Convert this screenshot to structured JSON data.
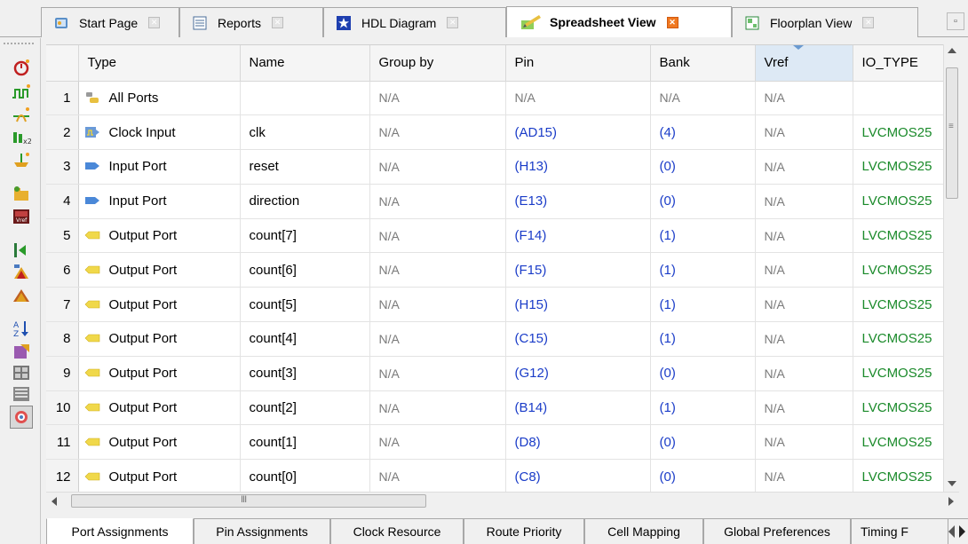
{
  "tabs": [
    {
      "label": "Start Page",
      "icon": "start-page-icon",
      "active": false
    },
    {
      "label": "Reports",
      "icon": "reports-icon",
      "active": false
    },
    {
      "label": "HDL Diagram",
      "icon": "hdl-diagram-icon",
      "active": false
    },
    {
      "label": "Spreadsheet View",
      "icon": "spreadsheet-icon",
      "active": true
    },
    {
      "label": "Floorplan View",
      "icon": "floorplan-icon",
      "active": false
    }
  ],
  "grid": {
    "columns": [
      "Type",
      "Name",
      "Group by",
      "Pin",
      "Bank",
      "Vref",
      "IO_TYPE"
    ],
    "rows": [
      {
        "n": "1",
        "type": "All Ports",
        "icon": "all-ports-icon",
        "name": "",
        "group": "N/A",
        "pin": "N/A",
        "bank": "N/A",
        "vref": "N/A",
        "iotype": ""
      },
      {
        "n": "2",
        "type": "Clock Input",
        "icon": "clock-input-icon",
        "name": "clk",
        "group": "N/A",
        "pin": "(AD15)",
        "bank": "(4)",
        "vref": "N/A",
        "iotype": "LVCMOS25"
      },
      {
        "n": "3",
        "type": "Input Port",
        "icon": "input-port-icon",
        "name": "reset",
        "group": "N/A",
        "pin": "(H13)",
        "bank": "(0)",
        "vref": "N/A",
        "iotype": "LVCMOS25"
      },
      {
        "n": "4",
        "type": "Input Port",
        "icon": "input-port-icon",
        "name": "direction",
        "group": "N/A",
        "pin": "(E13)",
        "bank": "(0)",
        "vref": "N/A",
        "iotype": "LVCMOS25"
      },
      {
        "n": "5",
        "type": "Output Port",
        "icon": "output-port-icon",
        "name": "count[7]",
        "group": "N/A",
        "pin": "(F14)",
        "bank": "(1)",
        "vref": "N/A",
        "iotype": "LVCMOS25"
      },
      {
        "n": "6",
        "type": "Output Port",
        "icon": "output-port-icon",
        "name": "count[6]",
        "group": "N/A",
        "pin": "(F15)",
        "bank": "(1)",
        "vref": "N/A",
        "iotype": "LVCMOS25"
      },
      {
        "n": "7",
        "type": "Output Port",
        "icon": "output-port-icon",
        "name": "count[5]",
        "group": "N/A",
        "pin": "(H15)",
        "bank": "(1)",
        "vref": "N/A",
        "iotype": "LVCMOS25"
      },
      {
        "n": "8",
        "type": "Output Port",
        "icon": "output-port-icon",
        "name": "count[4]",
        "group": "N/A",
        "pin": "(C15)",
        "bank": "(1)",
        "vref": "N/A",
        "iotype": "LVCMOS25"
      },
      {
        "n": "9",
        "type": "Output Port",
        "icon": "output-port-icon",
        "name": "count[3]",
        "group": "N/A",
        "pin": "(G12)",
        "bank": "(0)",
        "vref": "N/A",
        "iotype": "LVCMOS25"
      },
      {
        "n": "10",
        "type": "Output Port",
        "icon": "output-port-icon",
        "name": "count[2]",
        "group": "N/A",
        "pin": "(B14)",
        "bank": "(1)",
        "vref": "N/A",
        "iotype": "LVCMOS25"
      },
      {
        "n": "11",
        "type": "Output Port",
        "icon": "output-port-icon",
        "name": "count[1]",
        "group": "N/A",
        "pin": "(D8)",
        "bank": "(0)",
        "vref": "N/A",
        "iotype": "LVCMOS25"
      },
      {
        "n": "12",
        "type": "Output Port",
        "icon": "output-port-icon",
        "name": "count[0]",
        "group": "N/A",
        "pin": "(C8)",
        "bank": "(0)",
        "vref": "N/A",
        "iotype": "LVCMOS25"
      }
    ]
  },
  "bottom_tabs": [
    {
      "label": "Port Assignments",
      "active": true
    },
    {
      "label": "Pin Assignments",
      "active": false
    },
    {
      "label": "Clock Resource",
      "active": false
    },
    {
      "label": "Route Priority",
      "active": false
    },
    {
      "label": "Cell Mapping",
      "active": false
    },
    {
      "label": "Global Preferences",
      "active": false
    },
    {
      "label": "Timing F",
      "active": false
    }
  ],
  "toolbar_icons": [
    "clock-preference-icon",
    "waveform-icon",
    "pin-lock-icon",
    "multiplier-icon",
    "probe-icon",
    "folder-icon",
    "vref-icon",
    "split-icon",
    "warning-icon",
    "error-icon",
    "sort-icon",
    "export-icon",
    "group-icon",
    "ungroup-icon",
    "highlight-icon"
  ],
  "colors": {
    "pin_text": "#1a3cc8",
    "iotype_text": "#1a8a2a",
    "na_text": "#7a7a7a",
    "active_close": "#f07820"
  }
}
